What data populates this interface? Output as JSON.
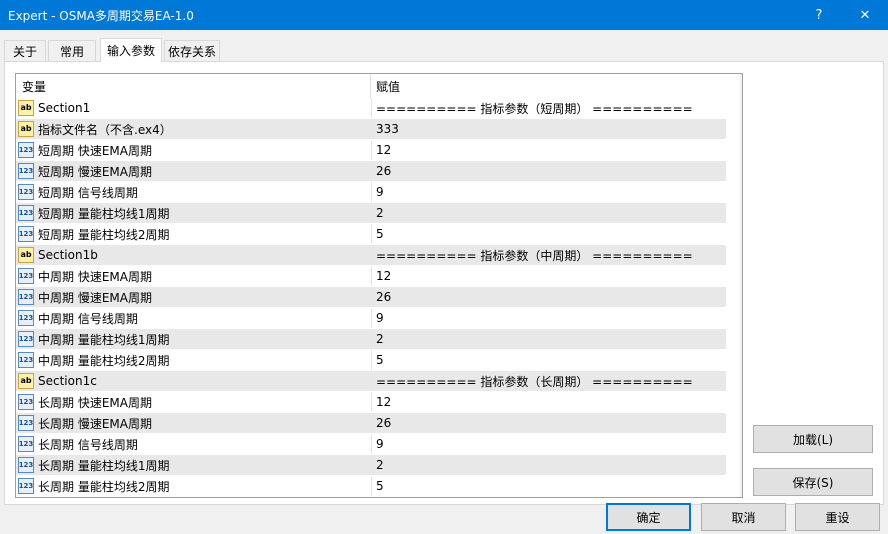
{
  "window": {
    "title": "Expert - OSMA多周期交易EA-1.0",
    "help_glyph": "?",
    "close_glyph": "✕"
  },
  "tabs": [
    {
      "label": "关于"
    },
    {
      "label": "常用"
    },
    {
      "label": "输入参数",
      "active": true
    },
    {
      "label": "依存关系"
    }
  ],
  "grid": {
    "col_variable": "变量",
    "col_value": "赋值",
    "rows": [
      {
        "type": "ab",
        "name": "Section1",
        "value": "========== 指标参数（短周期） =========="
      },
      {
        "type": "ab",
        "name": "指标文件名（不含.ex4）",
        "value": "333"
      },
      {
        "type": "num",
        "name": "短周期 快速EMA周期",
        "value": "12"
      },
      {
        "type": "num",
        "name": "短周期 慢速EMA周期",
        "value": "26"
      },
      {
        "type": "num",
        "name": "短周期 信号线周期",
        "value": "9"
      },
      {
        "type": "num",
        "name": "短周期 量能柱均线1周期",
        "value": "2"
      },
      {
        "type": "num",
        "name": "短周期 量能柱均线2周期",
        "value": "5"
      },
      {
        "type": "ab",
        "name": "Section1b",
        "value": "========== 指标参数（中周期） =========="
      },
      {
        "type": "num",
        "name": "中周期 快速EMA周期",
        "value": "12"
      },
      {
        "type": "num",
        "name": "中周期 慢速EMA周期",
        "value": "26"
      },
      {
        "type": "num",
        "name": "中周期 信号线周期",
        "value": "9"
      },
      {
        "type": "num",
        "name": "中周期 量能柱均线1周期",
        "value": "2"
      },
      {
        "type": "num",
        "name": "中周期 量能柱均线2周期",
        "value": "5"
      },
      {
        "type": "ab",
        "name": "Section1c",
        "value": "========== 指标参数（长周期） =========="
      },
      {
        "type": "num",
        "name": "长周期 快速EMA周期",
        "value": "12"
      },
      {
        "type": "num",
        "name": "长周期 慢速EMA周期",
        "value": "26"
      },
      {
        "type": "num",
        "name": "长周期 信号线周期",
        "value": "9"
      },
      {
        "type": "num",
        "name": "长周期 量能柱均线1周期",
        "value": "2"
      },
      {
        "type": "num",
        "name": "长周期 量能柱均线2周期",
        "value": "5"
      }
    ],
    "icon_text": {
      "ab": "ab",
      "num": "123"
    }
  },
  "scrollbar": {
    "up_glyph": "▲",
    "down_glyph": "▼"
  },
  "buttons": {
    "load": "加载(L)",
    "save": "保存(S)",
    "ok": "确定",
    "cancel": "取消",
    "reset": "重设"
  }
}
